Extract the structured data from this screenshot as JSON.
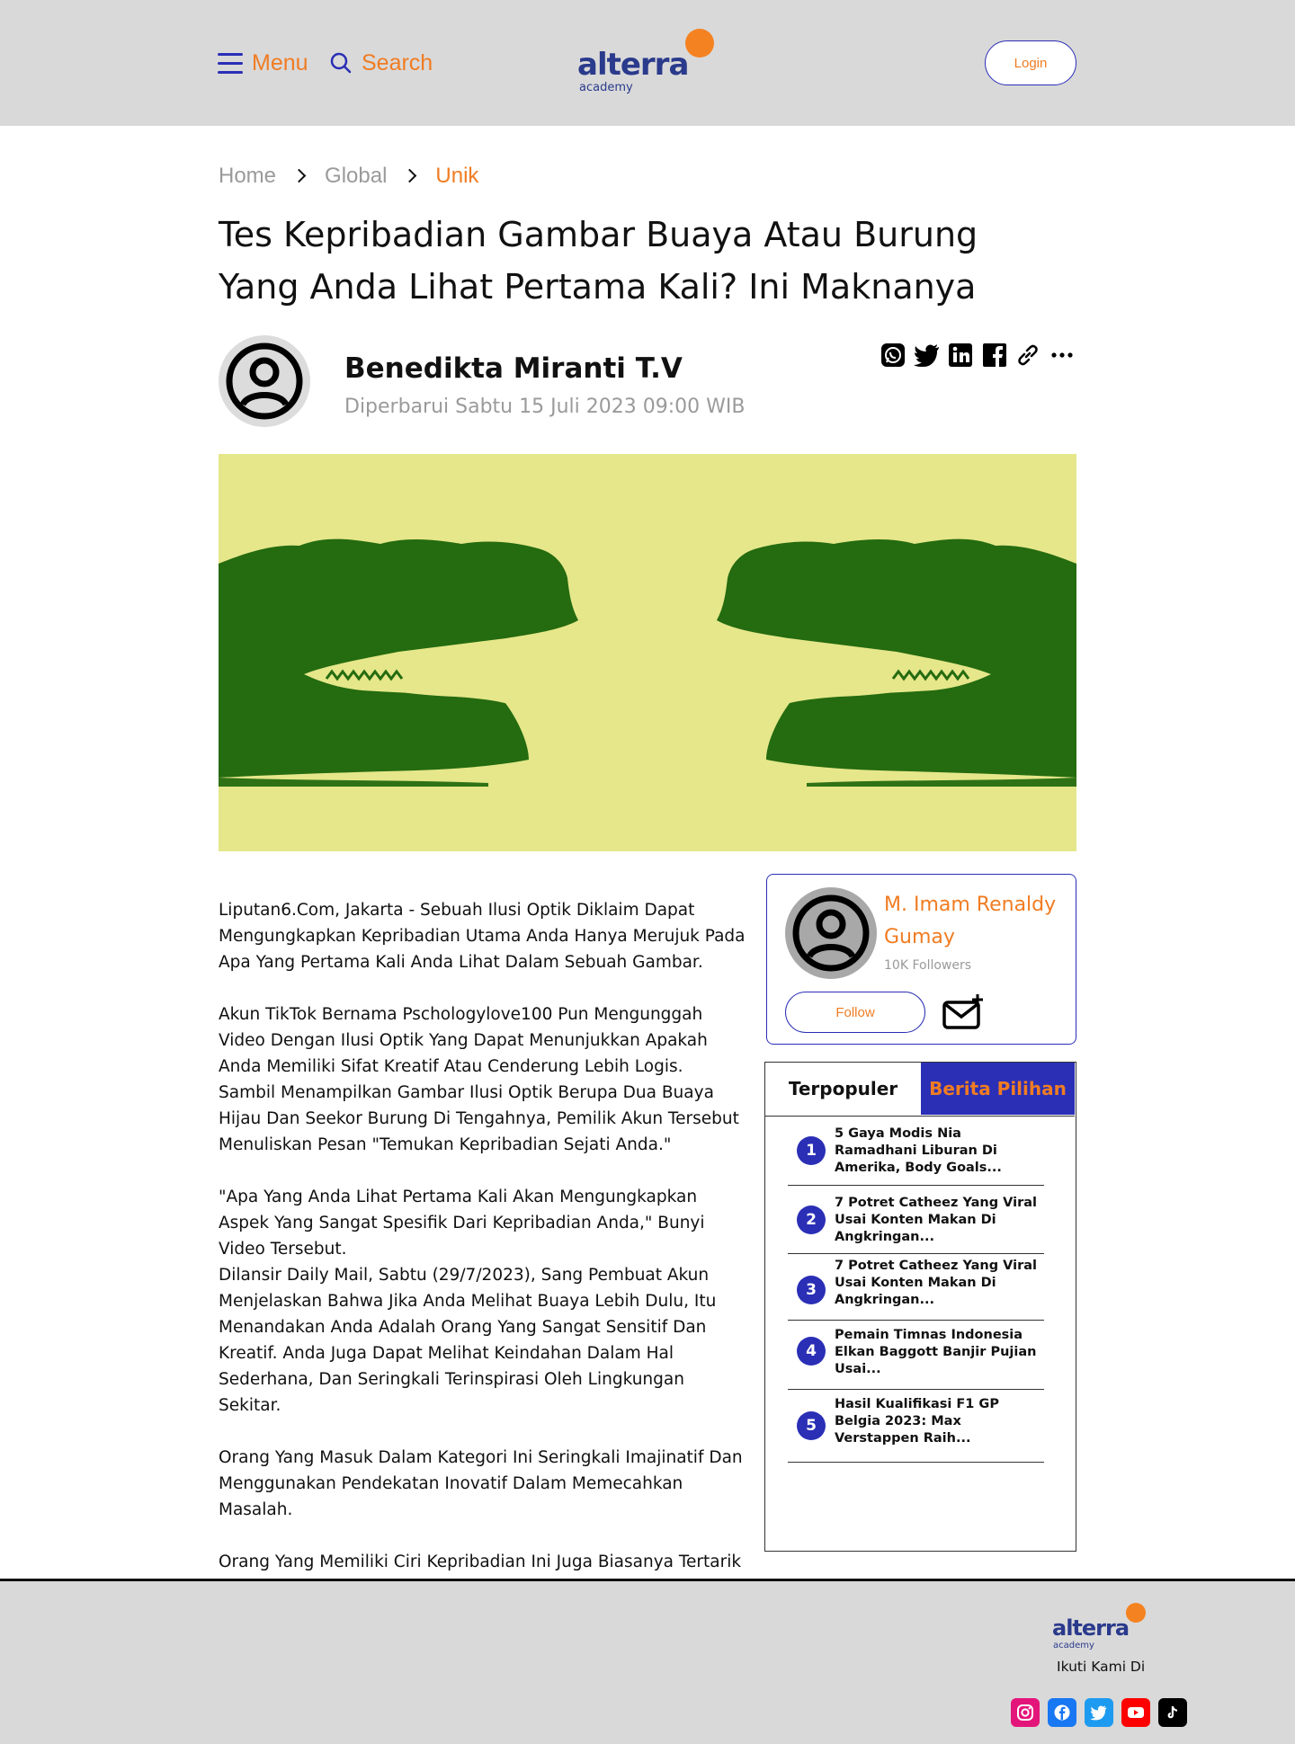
{
  "header": {
    "menu_label": "Menu",
    "search_label": "Search",
    "logo_text": "alterra",
    "logo_sub": "academy",
    "login_label": "Login"
  },
  "breadcrumb": [
    "Home",
    "Global",
    "Unik"
  ],
  "article": {
    "title": "Tes Kepribadian Gambar Buaya Atau Burung Yang Anda Lihat Pertama Kali? Ini Maknanya",
    "author": "Benedikta Miranti T.V",
    "updated": "Diperbarui Sabtu 15 Juli 2023 09:00 WIB",
    "share_icons": [
      "whatsapp-icon",
      "twitter-icon",
      "linkedin-icon",
      "facebook-icon",
      "link-icon",
      "more-icon"
    ],
    "paragraphs": [
      "Liputan6.Com, Jakarta - Sebuah Ilusi Optik Diklaim Dapat Mengungkapkan Kepribadian Utama Anda Hanya Merujuk Pada Apa Yang Pertama Kali Anda Lihat Dalam Sebuah Gambar.",
      "Akun TikTok Bernama Pschologylove100 Pun Mengunggah Video Dengan Ilusi Optik Yang Dapat Menunjukkan Apakah Anda Memiliki Sifat Kreatif Atau Cenderung Lebih Logis.",
      "Sambil Menampilkan Gambar Ilusi Optik Berupa Dua Buaya Hijau Dan Seekor Burung Di Tengahnya, Pemilik Akun Tersebut Menuliskan Pesan \"Temukan Kepribadian Sejati Anda.\"",
      "\"Apa Yang Anda Lihat Pertama Kali Akan Mengungkapkan Aspek Yang Sangat Spesifik Dari Kepribadian Anda,\" Bunyi Video Tersebut.",
      "Dilansir Daily Mail, Sabtu (29/7/2023), Sang Pembuat Akun Menjelaskan Bahwa Jika Anda Melihat Buaya Lebih Dulu, Itu Menandakan Anda Adalah Orang Yang Sangat Sensitif Dan Kreatif. Anda Juga Dapat Melihat Keindahan Dalam Hal Sederhana, Dan Seringkali Terinspirasi Oleh Lingkungan Sekitar.",
      "Orang Yang Masuk Dalam Kategori Ini Seringkali Imajinatif Dan Menggunakan Pendekatan Inovatif Dalam Memecahkan Masalah.",
      "Orang Yang Memiliki Ciri Kepribadian Ini Juga Biasanya Tertarik Dalam Dunia Seni Seperti Musik Dan Sastra."
    ]
  },
  "author_card": {
    "name": "M. Imam Renaldy Gumay",
    "followers": "10K Followers",
    "follow_label": "Follow"
  },
  "popular": {
    "tabs": [
      "Terpopuler",
      "Berita Pilihan"
    ],
    "items": [
      {
        "num": "1",
        "title": "5 Gaya Modis Nia Ramadhani Liburan Di Amerika, Body Goals..."
      },
      {
        "num": "2",
        "title": "7 Potret Catheez Yang Viral Usai Konten Makan Di Angkringan..."
      },
      {
        "num": "3",
        "title": "7 Potret Catheez Yang Viral Usai Konten Makan Di Angkringan..."
      },
      {
        "num": "4",
        "title": "Pemain Timnas Indonesia Elkan Baggott Banjir Pujian Usai..."
      },
      {
        "num": "5",
        "title": "Hasil Kualifikasi F1 GP Belgia 2023: Max Verstappen Raih..."
      }
    ]
  },
  "footer": {
    "logo_text": "alterra",
    "logo_sub": "academy",
    "follow_text": "Ikuti Kami Di",
    "socials": [
      "instagram-icon",
      "facebook-icon",
      "twitter-icon",
      "youtube-icon",
      "tiktok-icon"
    ]
  },
  "colors": {
    "accent_orange": "#f07c22",
    "brand_blue": "#2a2fb6",
    "header_gray": "#d9d9d9"
  }
}
